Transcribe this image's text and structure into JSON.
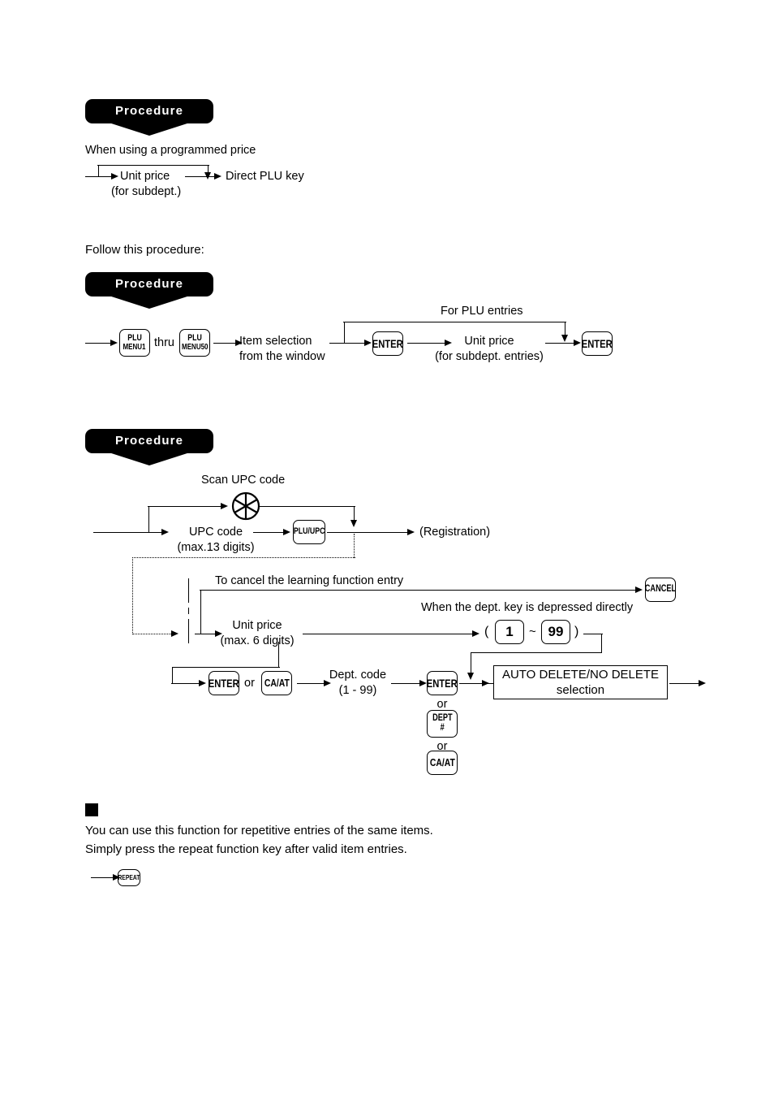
{
  "page": {
    "banner_label": "Procedure"
  },
  "section1": {
    "banner": "Procedure",
    "note": "When using a programmed price",
    "step_unit_price": "Unit price",
    "step_unit_price_sub": "(for subdept.)",
    "step_direct_plu": "Direct PLU key"
  },
  "section2": {
    "intro": "Follow this procedure:",
    "banner": "Procedure",
    "key_plu_menu1_l1": "PLU",
    "key_plu_menu1_l2": "MENU1",
    "thru": "thru",
    "key_plu_menu50_l1": "PLU",
    "key_plu_menu50_l2": "MENU50",
    "item_selection_l1": "Item selection",
    "item_selection_l2": "from the window",
    "key_enter_1": "ENTER",
    "branch_label": "For PLU entries",
    "unit_price_l1": "Unit price",
    "unit_price_l2": "(for subdept. entries)",
    "key_enter_2": "ENTER"
  },
  "section3": {
    "banner": "Procedure",
    "scan_label": "Scan UPC code",
    "upc_code_l1": "UPC code",
    "upc_code_l2": "(max.13 digits)",
    "key_plu_upc": "PLU/UPC",
    "registration": "(Registration)",
    "cancel_label": "To cancel the learning function entry",
    "key_cancel": "CANCEL",
    "dept_direct_label": "When the dept. key is depressed directly",
    "unit_price_l1": "Unit price",
    "unit_price_l2": "(max. 6 digits)",
    "paren_open": "(",
    "key_dept_1": "1",
    "tilde": "~",
    "key_dept_99": "99",
    "paren_close": ")",
    "key_enter_a": "ENTER",
    "or_1": "or",
    "key_caat_a": "CA/AT",
    "dept_code_l1": "Dept. code",
    "dept_code_l2": "(1 - 99)",
    "key_enter_b": "ENTER",
    "or_2": "or",
    "key_dept_hash_l1": "DEPT",
    "key_dept_hash_l2": "#",
    "or_3": "or",
    "key_caat_b": "CA/AT",
    "auto_delete_l1": "AUTO DELETE/NO DELETE",
    "auto_delete_l2": "selection"
  },
  "section4": {
    "body_line1": "You can use this function for repetitive entries of the same items.",
    "body_line2": "Simply press the repeat function key after valid item entries.",
    "key_repeat": "REPEAT"
  },
  "icons": {
    "scanner": "scanner-icon",
    "bullet": "black-square-bullet"
  }
}
